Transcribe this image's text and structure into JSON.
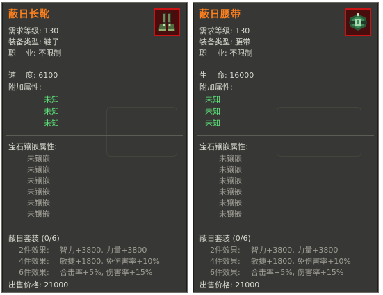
{
  "left": {
    "title": "蔽日长靴",
    "item_icon": "boots-icon",
    "req_level_label": "需求等级:",
    "req_level_value": "130",
    "equip_type_label": "装备类型:",
    "equip_type_value": "鞋子",
    "job_label": "职    业:",
    "job_value": "不限制",
    "stat_label": "速    度:",
    "stat_value": "6100",
    "extra_attr_label": "附加属性:",
    "extra_attrs": [
      "未知",
      "未知",
      "未知"
    ],
    "gem_label": "宝石镶嵌属性:",
    "gems": [
      "未镶嵌",
      "未镶嵌",
      "未镶嵌",
      "未镶嵌",
      "未镶嵌",
      "未镶嵌"
    ],
    "set_name": "蔽日套装 (0/6)",
    "set_effects": [
      {
        "label": "2件效果:",
        "value": "智力+3800, 力量+3800"
      },
      {
        "label": "4件效果:",
        "value": "敏捷+1800, 免伤害率+10%"
      },
      {
        "label": "6件效果:",
        "value": "合击率+5%, 伤害率+15%"
      }
    ],
    "price_label": "出售价格:",
    "price_value": "21000"
  },
  "right": {
    "title": "蔽日腰带",
    "item_icon": "belt-icon",
    "req_level_label": "需求等级:",
    "req_level_value": "130",
    "equip_type_label": "装备类型:",
    "equip_type_value": "腰带",
    "job_label": "职    业:",
    "job_value": "不限制",
    "stat_label": "生    命:",
    "stat_value": "16000",
    "extra_attr_label": "附加属性:",
    "extra_attrs": [
      "未知",
      "未知",
      "未知"
    ],
    "gem_label": "宝石镶嵌属性:",
    "gems": [
      "未镶嵌",
      "未镶嵌",
      "未镶嵌",
      "未镶嵌",
      "未镶嵌",
      "未镶嵌"
    ],
    "set_name": "蔽日套装 (0/6)",
    "set_effects": [
      {
        "label": "2件效果:",
        "value": "智力+3800, 力量+3800"
      },
      {
        "label": "4件效果:",
        "value": "敏捷+1800, 免伤害率+10%"
      },
      {
        "label": "6件效果:",
        "value": "合击率+5%, 伤害率+15%"
      }
    ],
    "price_label": "出售价格:",
    "price_value": "21000"
  },
  "colors": {
    "title": "#ff7f1c",
    "unknown_attr": "#5ce87a",
    "panel_bg": "#373835",
    "icon_border": "#c81414"
  }
}
